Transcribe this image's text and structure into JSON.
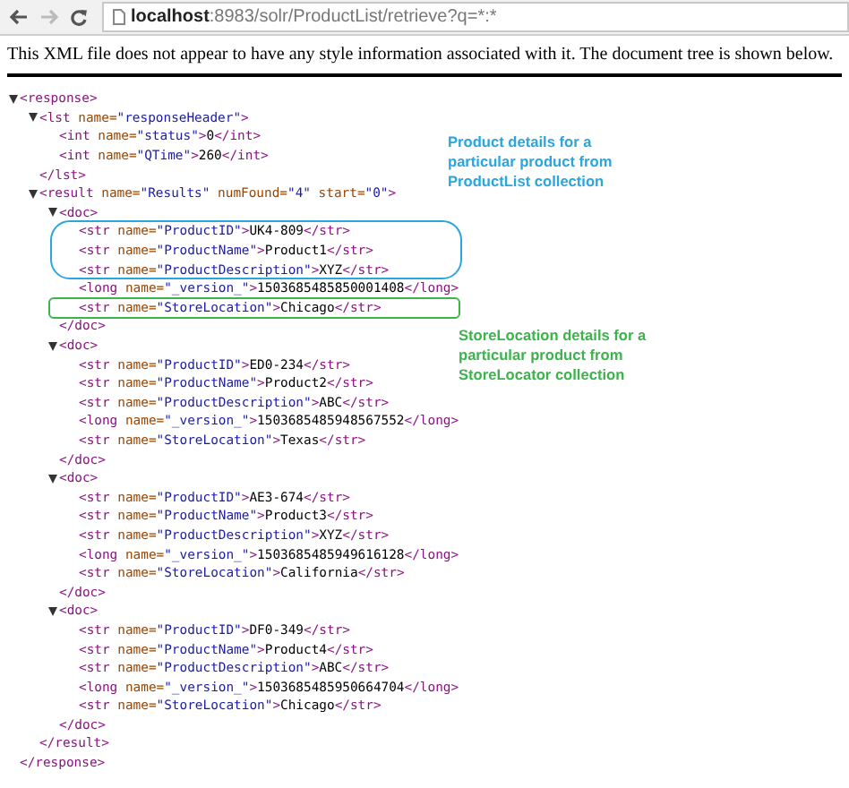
{
  "browser": {
    "url_host": "localhost",
    "url_path": ":8983/solr/ProductList/retrieve?q=*:*"
  },
  "notice": "This XML file does not appear to have any style information associated with it. The document tree is shown below.",
  "tree": {
    "expanded": true,
    "open": [
      {
        "kind": "tag",
        "text": "<response>"
      }
    ],
    "close": [
      {
        "kind": "tag",
        "text": "</response>"
      }
    ],
    "children": [
      {
        "expanded": true,
        "open": [
          {
            "kind": "tag",
            "text": "<lst "
          },
          {
            "kind": "attr",
            "text": "name="
          },
          {
            "kind": "value",
            "text": "\"responseHeader\""
          },
          {
            "kind": "tag",
            "text": ">"
          }
        ],
        "close": [
          {
            "kind": "tag",
            "text": "</lst>"
          }
        ],
        "children": [
          {
            "line": [
              {
                "kind": "tag",
                "text": "<int "
              },
              {
                "kind": "attr",
                "text": "name="
              },
              {
                "kind": "value",
                "text": "\"status\""
              },
              {
                "kind": "tag",
                "text": ">"
              },
              {
                "kind": "text",
                "text": "0"
              },
              {
                "kind": "tag",
                "text": "</int>"
              }
            ]
          },
          {
            "line": [
              {
                "kind": "tag",
                "text": "<int "
              },
              {
                "kind": "attr",
                "text": "name="
              },
              {
                "kind": "value",
                "text": "\"QTime\""
              },
              {
                "kind": "tag",
                "text": ">"
              },
              {
                "kind": "text",
                "text": "260"
              },
              {
                "kind": "tag",
                "text": "</int>"
              }
            ]
          }
        ]
      },
      {
        "expanded": true,
        "open": [
          {
            "kind": "tag",
            "text": "<result "
          },
          {
            "kind": "attr",
            "text": "name="
          },
          {
            "kind": "value",
            "text": "\"Results\""
          },
          {
            "kind": "attr",
            "text": " numFound="
          },
          {
            "kind": "value",
            "text": "\"4\""
          },
          {
            "kind": "attr",
            "text": " start="
          },
          {
            "kind": "value",
            "text": "\"0\""
          },
          {
            "kind": "tag",
            "text": ">"
          }
        ],
        "close": [
          {
            "kind": "tag",
            "text": "</result>"
          }
        ],
        "children": [
          {
            "expanded": true,
            "open": [
              {
                "kind": "tag",
                "text": "<doc>"
              }
            ],
            "close": [
              {
                "kind": "tag",
                "text": "</doc>"
              }
            ],
            "children": [
              {
                "line": [
                  {
                    "kind": "tag",
                    "text": "<str "
                  },
                  {
                    "kind": "attr",
                    "text": "name="
                  },
                  {
                    "kind": "value",
                    "text": "\"ProductID\""
                  },
                  {
                    "kind": "tag",
                    "text": ">"
                  },
                  {
                    "kind": "text",
                    "text": "UK4-809"
                  },
                  {
                    "kind": "tag",
                    "text": "</str>"
                  }
                ]
              },
              {
                "line": [
                  {
                    "kind": "tag",
                    "text": "<str "
                  },
                  {
                    "kind": "attr",
                    "text": "name="
                  },
                  {
                    "kind": "value",
                    "text": "\"ProductName\""
                  },
                  {
                    "kind": "tag",
                    "text": ">"
                  },
                  {
                    "kind": "text",
                    "text": "Product1"
                  },
                  {
                    "kind": "tag",
                    "text": "</str>"
                  }
                ]
              },
              {
                "line": [
                  {
                    "kind": "tag",
                    "text": "<str "
                  },
                  {
                    "kind": "attr",
                    "text": "name="
                  },
                  {
                    "kind": "value",
                    "text": "\"ProductDescription\""
                  },
                  {
                    "kind": "tag",
                    "text": ">"
                  },
                  {
                    "kind": "text",
                    "text": "XYZ"
                  },
                  {
                    "kind": "tag",
                    "text": "</str>"
                  }
                ]
              },
              {
                "line": [
                  {
                    "kind": "tag",
                    "text": "<long "
                  },
                  {
                    "kind": "attr",
                    "text": "name="
                  },
                  {
                    "kind": "value",
                    "text": "\"_version_\""
                  },
                  {
                    "kind": "tag",
                    "text": ">"
                  },
                  {
                    "kind": "text",
                    "text": "1503685485850001408"
                  },
                  {
                    "kind": "tag",
                    "text": "</long>"
                  }
                ]
              },
              {
                "line": [
                  {
                    "kind": "tag",
                    "text": "<str "
                  },
                  {
                    "kind": "attr",
                    "text": "name="
                  },
                  {
                    "kind": "value",
                    "text": "\"StoreLocation\""
                  },
                  {
                    "kind": "tag",
                    "text": ">"
                  },
                  {
                    "kind": "text",
                    "text": "Chicago"
                  },
                  {
                    "kind": "tag",
                    "text": "</str>"
                  }
                ]
              }
            ]
          },
          {
            "expanded": true,
            "open": [
              {
                "kind": "tag",
                "text": "<doc>"
              }
            ],
            "close": [
              {
                "kind": "tag",
                "text": "</doc>"
              }
            ],
            "children": [
              {
                "line": [
                  {
                    "kind": "tag",
                    "text": "<str "
                  },
                  {
                    "kind": "attr",
                    "text": "name="
                  },
                  {
                    "kind": "value",
                    "text": "\"ProductID\""
                  },
                  {
                    "kind": "tag",
                    "text": ">"
                  },
                  {
                    "kind": "text",
                    "text": "ED0-234"
                  },
                  {
                    "kind": "tag",
                    "text": "</str>"
                  }
                ]
              },
              {
                "line": [
                  {
                    "kind": "tag",
                    "text": "<str "
                  },
                  {
                    "kind": "attr",
                    "text": "name="
                  },
                  {
                    "kind": "value",
                    "text": "\"ProductName\""
                  },
                  {
                    "kind": "tag",
                    "text": ">"
                  },
                  {
                    "kind": "text",
                    "text": "Product2"
                  },
                  {
                    "kind": "tag",
                    "text": "</str>"
                  }
                ]
              },
              {
                "line": [
                  {
                    "kind": "tag",
                    "text": "<str "
                  },
                  {
                    "kind": "attr",
                    "text": "name="
                  },
                  {
                    "kind": "value",
                    "text": "\"ProductDescription\""
                  },
                  {
                    "kind": "tag",
                    "text": ">"
                  },
                  {
                    "kind": "text",
                    "text": "ABC"
                  },
                  {
                    "kind": "tag",
                    "text": "</str>"
                  }
                ]
              },
              {
                "line": [
                  {
                    "kind": "tag",
                    "text": "<long "
                  },
                  {
                    "kind": "attr",
                    "text": "name="
                  },
                  {
                    "kind": "value",
                    "text": "\"_version_\""
                  },
                  {
                    "kind": "tag",
                    "text": ">"
                  },
                  {
                    "kind": "text",
                    "text": "1503685485948567552"
                  },
                  {
                    "kind": "tag",
                    "text": "</long>"
                  }
                ]
              },
              {
                "line": [
                  {
                    "kind": "tag",
                    "text": "<str "
                  },
                  {
                    "kind": "attr",
                    "text": "name="
                  },
                  {
                    "kind": "value",
                    "text": "\"StoreLocation\""
                  },
                  {
                    "kind": "tag",
                    "text": ">"
                  },
                  {
                    "kind": "text",
                    "text": "Texas"
                  },
                  {
                    "kind": "tag",
                    "text": "</str>"
                  }
                ]
              }
            ]
          },
          {
            "expanded": true,
            "open": [
              {
                "kind": "tag",
                "text": "<doc>"
              }
            ],
            "close": [
              {
                "kind": "tag",
                "text": "</doc>"
              }
            ],
            "children": [
              {
                "line": [
                  {
                    "kind": "tag",
                    "text": "<str "
                  },
                  {
                    "kind": "attr",
                    "text": "name="
                  },
                  {
                    "kind": "value",
                    "text": "\"ProductID\""
                  },
                  {
                    "kind": "tag",
                    "text": ">"
                  },
                  {
                    "kind": "text",
                    "text": "AE3-674"
                  },
                  {
                    "kind": "tag",
                    "text": "</str>"
                  }
                ]
              },
              {
                "line": [
                  {
                    "kind": "tag",
                    "text": "<str "
                  },
                  {
                    "kind": "attr",
                    "text": "name="
                  },
                  {
                    "kind": "value",
                    "text": "\"ProductName\""
                  },
                  {
                    "kind": "tag",
                    "text": ">"
                  },
                  {
                    "kind": "text",
                    "text": "Product3"
                  },
                  {
                    "kind": "tag",
                    "text": "</str>"
                  }
                ]
              },
              {
                "line": [
                  {
                    "kind": "tag",
                    "text": "<str "
                  },
                  {
                    "kind": "attr",
                    "text": "name="
                  },
                  {
                    "kind": "value",
                    "text": "\"ProductDescription\""
                  },
                  {
                    "kind": "tag",
                    "text": ">"
                  },
                  {
                    "kind": "text",
                    "text": "XYZ"
                  },
                  {
                    "kind": "tag",
                    "text": "</str>"
                  }
                ]
              },
              {
                "line": [
                  {
                    "kind": "tag",
                    "text": "<long "
                  },
                  {
                    "kind": "attr",
                    "text": "name="
                  },
                  {
                    "kind": "value",
                    "text": "\"_version_\""
                  },
                  {
                    "kind": "tag",
                    "text": ">"
                  },
                  {
                    "kind": "text",
                    "text": "1503685485949616128"
                  },
                  {
                    "kind": "tag",
                    "text": "</long>"
                  }
                ]
              },
              {
                "line": [
                  {
                    "kind": "tag",
                    "text": "<str "
                  },
                  {
                    "kind": "attr",
                    "text": "name="
                  },
                  {
                    "kind": "value",
                    "text": "\"StoreLocation\""
                  },
                  {
                    "kind": "tag",
                    "text": ">"
                  },
                  {
                    "kind": "text",
                    "text": "California"
                  },
                  {
                    "kind": "tag",
                    "text": "</str>"
                  }
                ]
              }
            ]
          },
          {
            "expanded": true,
            "open": [
              {
                "kind": "tag",
                "text": "<doc>"
              }
            ],
            "close": [
              {
                "kind": "tag",
                "text": "</doc>"
              }
            ],
            "children": [
              {
                "line": [
                  {
                    "kind": "tag",
                    "text": "<str "
                  },
                  {
                    "kind": "attr",
                    "text": "name="
                  },
                  {
                    "kind": "value",
                    "text": "\"ProductID\""
                  },
                  {
                    "kind": "tag",
                    "text": ">"
                  },
                  {
                    "kind": "text",
                    "text": "DF0-349"
                  },
                  {
                    "kind": "tag",
                    "text": "</str>"
                  }
                ]
              },
              {
                "line": [
                  {
                    "kind": "tag",
                    "text": "<str "
                  },
                  {
                    "kind": "attr",
                    "text": "name="
                  },
                  {
                    "kind": "value",
                    "text": "\"ProductName\""
                  },
                  {
                    "kind": "tag",
                    "text": ">"
                  },
                  {
                    "kind": "text",
                    "text": "Product4"
                  },
                  {
                    "kind": "tag",
                    "text": "</str>"
                  }
                ]
              },
              {
                "line": [
                  {
                    "kind": "tag",
                    "text": "<str "
                  },
                  {
                    "kind": "attr",
                    "text": "name="
                  },
                  {
                    "kind": "value",
                    "text": "\"ProductDescription\""
                  },
                  {
                    "kind": "tag",
                    "text": ">"
                  },
                  {
                    "kind": "text",
                    "text": "ABC"
                  },
                  {
                    "kind": "tag",
                    "text": "</str>"
                  }
                ]
              },
              {
                "line": [
                  {
                    "kind": "tag",
                    "text": "<long "
                  },
                  {
                    "kind": "attr",
                    "text": "name="
                  },
                  {
                    "kind": "value",
                    "text": "\"_version_\""
                  },
                  {
                    "kind": "tag",
                    "text": ">"
                  },
                  {
                    "kind": "text",
                    "text": "1503685485950664704"
                  },
                  {
                    "kind": "tag",
                    "text": "</long>"
                  }
                ]
              },
              {
                "line": [
                  {
                    "kind": "tag",
                    "text": "<str "
                  },
                  {
                    "kind": "attr",
                    "text": "name="
                  },
                  {
                    "kind": "value",
                    "text": "\"StoreLocation\""
                  },
                  {
                    "kind": "tag",
                    "text": ">"
                  },
                  {
                    "kind": "text",
                    "text": "Chicago"
                  },
                  {
                    "kind": "tag",
                    "text": "</str>"
                  }
                ]
              }
            ]
          }
        ]
      }
    ]
  },
  "notes": [
    {
      "text": "Product details for a particular product from ProductList collection",
      "color": "#29a6df"
    },
    {
      "text": "StoreLocation details for a particular product from StoreLocator collection",
      "color": "#3cb44b"
    }
  ]
}
